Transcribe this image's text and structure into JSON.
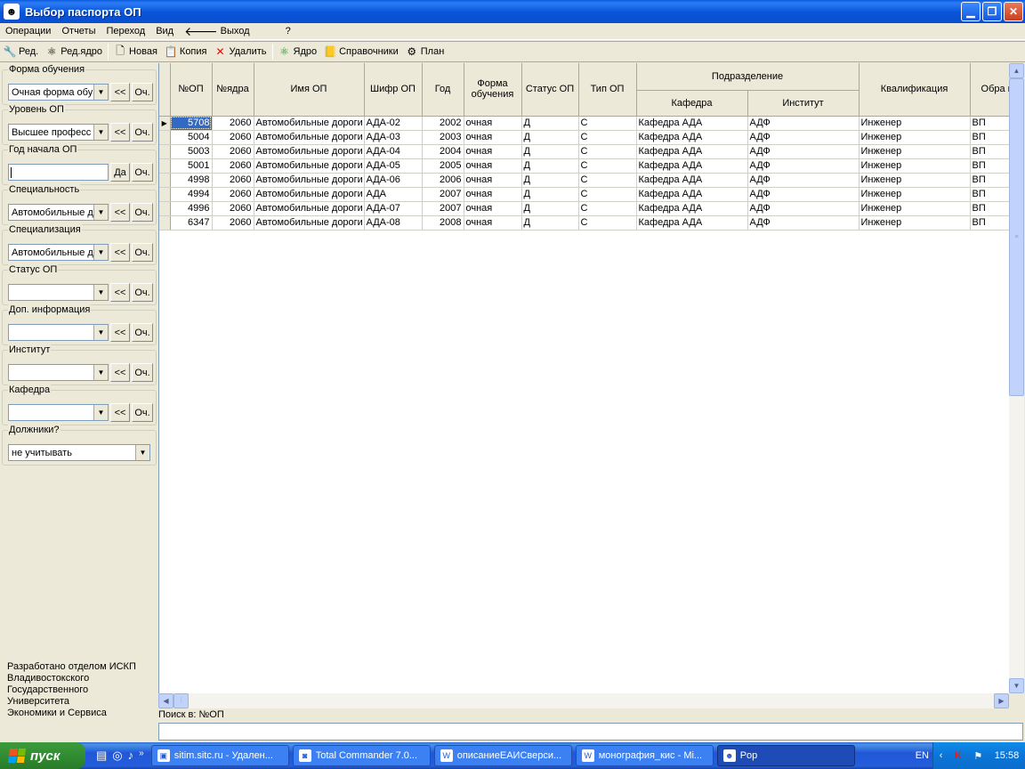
{
  "window": {
    "title": "Выбор паспорта ОП"
  },
  "menu": [
    "Операции",
    "Отчеты",
    "Переход",
    "Вид",
    "Выход",
    "?"
  ],
  "toolbar": [
    "Ред.",
    "Ред.ядро",
    "Новая",
    "Копия",
    "Удалить",
    "Ядро",
    "Справочники",
    "План"
  ],
  "filters": [
    {
      "label": "Форма обучения",
      "value": "Очная форма обу",
      "btn1": "<<",
      "btn2": "Оч."
    },
    {
      "label": "Уровень ОП",
      "value": "Высшее професс",
      "btn1": "<<",
      "btn2": "Оч."
    },
    {
      "label": "Год начала ОП",
      "value": "",
      "btn1": "Да",
      "btn2": "Оч."
    },
    {
      "label": "Специальность",
      "value": "Автомобильные д",
      "btn1": "<<",
      "btn2": "Оч."
    },
    {
      "label": "Специализация",
      "value": "Автомобильные д",
      "btn1": "<<",
      "btn2": "Оч."
    },
    {
      "label": "Статус ОП",
      "value": "",
      "btn1": "<<",
      "btn2": "Оч."
    },
    {
      "label": "Доп. информация",
      "value": "",
      "btn1": "<<",
      "btn2": "Оч."
    },
    {
      "label": "Институт",
      "value": "",
      "btn1": "<<",
      "btn2": "Оч."
    },
    {
      "label": "Кафедра",
      "value": "",
      "btn1": "<<",
      "btn2": "Оч."
    }
  ],
  "debtors": {
    "label": "Должники?",
    "value": "не учитывать"
  },
  "credit": [
    "Разработано отделом ИСКП",
    "Владивостокского",
    "Государственного",
    "Университета",
    "Экономики и Сервиса"
  ],
  "grid": {
    "headers": {
      "op_no": "№ОП",
      "core_no": "№ядра",
      "name": "Имя ОП",
      "code": "Шифр ОП",
      "year": "Год",
      "form": "Форма обучения",
      "status": "Статус ОП",
      "type": "Тип ОП",
      "division": "Подразделение",
      "dept": "Кафедра",
      "inst": "Институт",
      "qual": "Квалификация",
      "edu": "Обра ценз"
    },
    "rows": [
      [
        "5708",
        "2060",
        "Автомобильные дороги",
        "АДА-02",
        "2002",
        "очная",
        "Д",
        "С",
        "Кафедра АДА",
        "АДФ",
        "Инженер",
        "ВП"
      ],
      [
        "5004",
        "2060",
        "Автомобильные дороги",
        "АДА-03",
        "2003",
        "очная",
        "Д",
        "С",
        "Кафедра АДА",
        "АДФ",
        "Инженер",
        "ВП"
      ],
      [
        "5003",
        "2060",
        "Автомобильные дороги",
        "АДА-04",
        "2004",
        "очная",
        "Д",
        "С",
        "Кафедра АДА",
        "АДФ",
        "Инженер",
        "ВП"
      ],
      [
        "5001",
        "2060",
        "Автомобильные дороги",
        "АДА-05",
        "2005",
        "очная",
        "Д",
        "С",
        "Кафедра АДА",
        "АДФ",
        "Инженер",
        "ВП"
      ],
      [
        "4998",
        "2060",
        "Автомобильные дороги",
        "АДА-06",
        "2006",
        "очная",
        "Д",
        "С",
        "Кафедра АДА",
        "АДФ",
        "Инженер",
        "ВП"
      ],
      [
        "4994",
        "2060",
        "Автомобильные дороги",
        "АДА",
        "2007",
        "очная",
        "Д",
        "С",
        "Кафедра АДА",
        "АДФ",
        "Инженер",
        "ВП"
      ],
      [
        "4996",
        "2060",
        "Автомобильные дороги",
        "АДА-07",
        "2007",
        "очная",
        "Д",
        "С",
        "Кафедра АДА",
        "АДФ",
        "Инженер",
        "ВП"
      ],
      [
        "6347",
        "2060",
        "Автомобильные дороги",
        "АДА-08",
        "2008",
        "очная",
        "Д",
        "С",
        "Кафедра АДА",
        "АДФ",
        "Инженер",
        "ВП"
      ]
    ]
  },
  "search": {
    "label": "Поиск в: №ОП",
    "value": ""
  },
  "taskbar": {
    "start": "пуск",
    "tasks": [
      "sitim.sitc.ru - Удален...",
      "Total Commander 7.0...",
      "описаниеЕАИСверси...",
      "монография_кис - Mi...",
      "Pop"
    ],
    "lang": "EN",
    "clock": "15:58"
  }
}
